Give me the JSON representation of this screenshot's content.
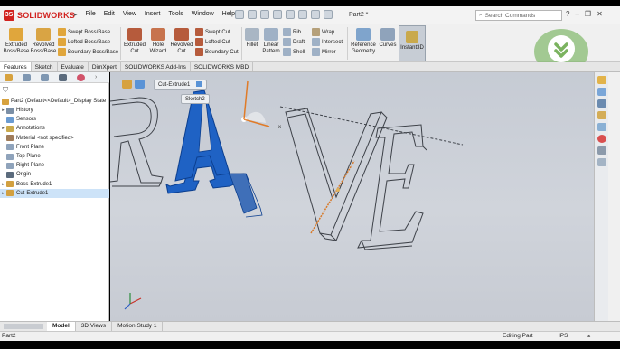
{
  "app": {
    "brand": "SOLIDWORKS",
    "document_title": "Part2 *",
    "menu": [
      "File",
      "Edit",
      "View",
      "Insert",
      "Tools",
      "Window",
      "Help"
    ],
    "search_placeholder": "Search Commands"
  },
  "commands": {
    "extruded_boss": "Extruded\nBoss/Base",
    "revolved_boss": "Revolved\nBoss/Base",
    "swept_boss": "Swept Boss/Base",
    "lofted_boss": "Lofted Boss/Base",
    "boundary_boss": "Boundary Boss/Base",
    "extruded_cut": "Extruded\nCut",
    "hole_wizard": "Hole\nWizard",
    "revolved_cut": "Revolved\nCut",
    "swept_cut": "Swept Cut",
    "lofted_cut": "Lofted Cut",
    "boundary_cut": "Boundary Cut",
    "fillet": "Fillet",
    "linear_pattern": "Linear\nPattern",
    "rib": "Rib",
    "draft": "Draft",
    "shell": "Shell",
    "wrap": "Wrap",
    "intersect": "Intersect",
    "mirror": "Mirror",
    "reference_geometry": "Reference\nGeometry",
    "curves": "Curves",
    "instant3d": "Instant3D"
  },
  "tabs": [
    "Features",
    "Sketch",
    "Evaluate",
    "DimXpert",
    "SOLIDWORKS Add-Ins",
    "SOLIDWORKS MBD"
  ],
  "tree": {
    "root": "Part2  (Default<<Default>_Display State",
    "items": [
      {
        "label": "History",
        "icon_color": "#7b8fa6"
      },
      {
        "label": "Sensors",
        "icon_color": "#6a9bd1"
      },
      {
        "label": "Annotations",
        "icon_color": "#c9a94c"
      },
      {
        "label": "Material <not specified>",
        "icon_color": "#a07c5a"
      },
      {
        "label": "Front Plane",
        "icon_color": "#8fa3bb"
      },
      {
        "label": "Top Plane",
        "icon_color": "#8fa3bb"
      },
      {
        "label": "Right Plane",
        "icon_color": "#8fa3bb"
      },
      {
        "label": "Origin",
        "icon_color": "#5b6b7d"
      },
      {
        "label": "Boss-Extrude1",
        "icon_color": "#d2a040"
      },
      {
        "label": "Cut-Extrude1",
        "icon_color": "#d2a040"
      }
    ]
  },
  "viewport": {
    "breadcrumb": "Cut-Extrude1",
    "breadcrumb_sub": "Sketch2",
    "axis_label_x": "x",
    "model_text": "RAVE"
  },
  "bottom_tabs": [
    "Model",
    "3D Views",
    "Motion Study 1"
  ],
  "status": {
    "left": "Part2",
    "mode": "Editing Part",
    "units": "IPS"
  },
  "colors": {
    "accent_red": "#d1221f",
    "selection_blue": "#1f62c4",
    "viewport_bg": "#c9cdd5"
  }
}
